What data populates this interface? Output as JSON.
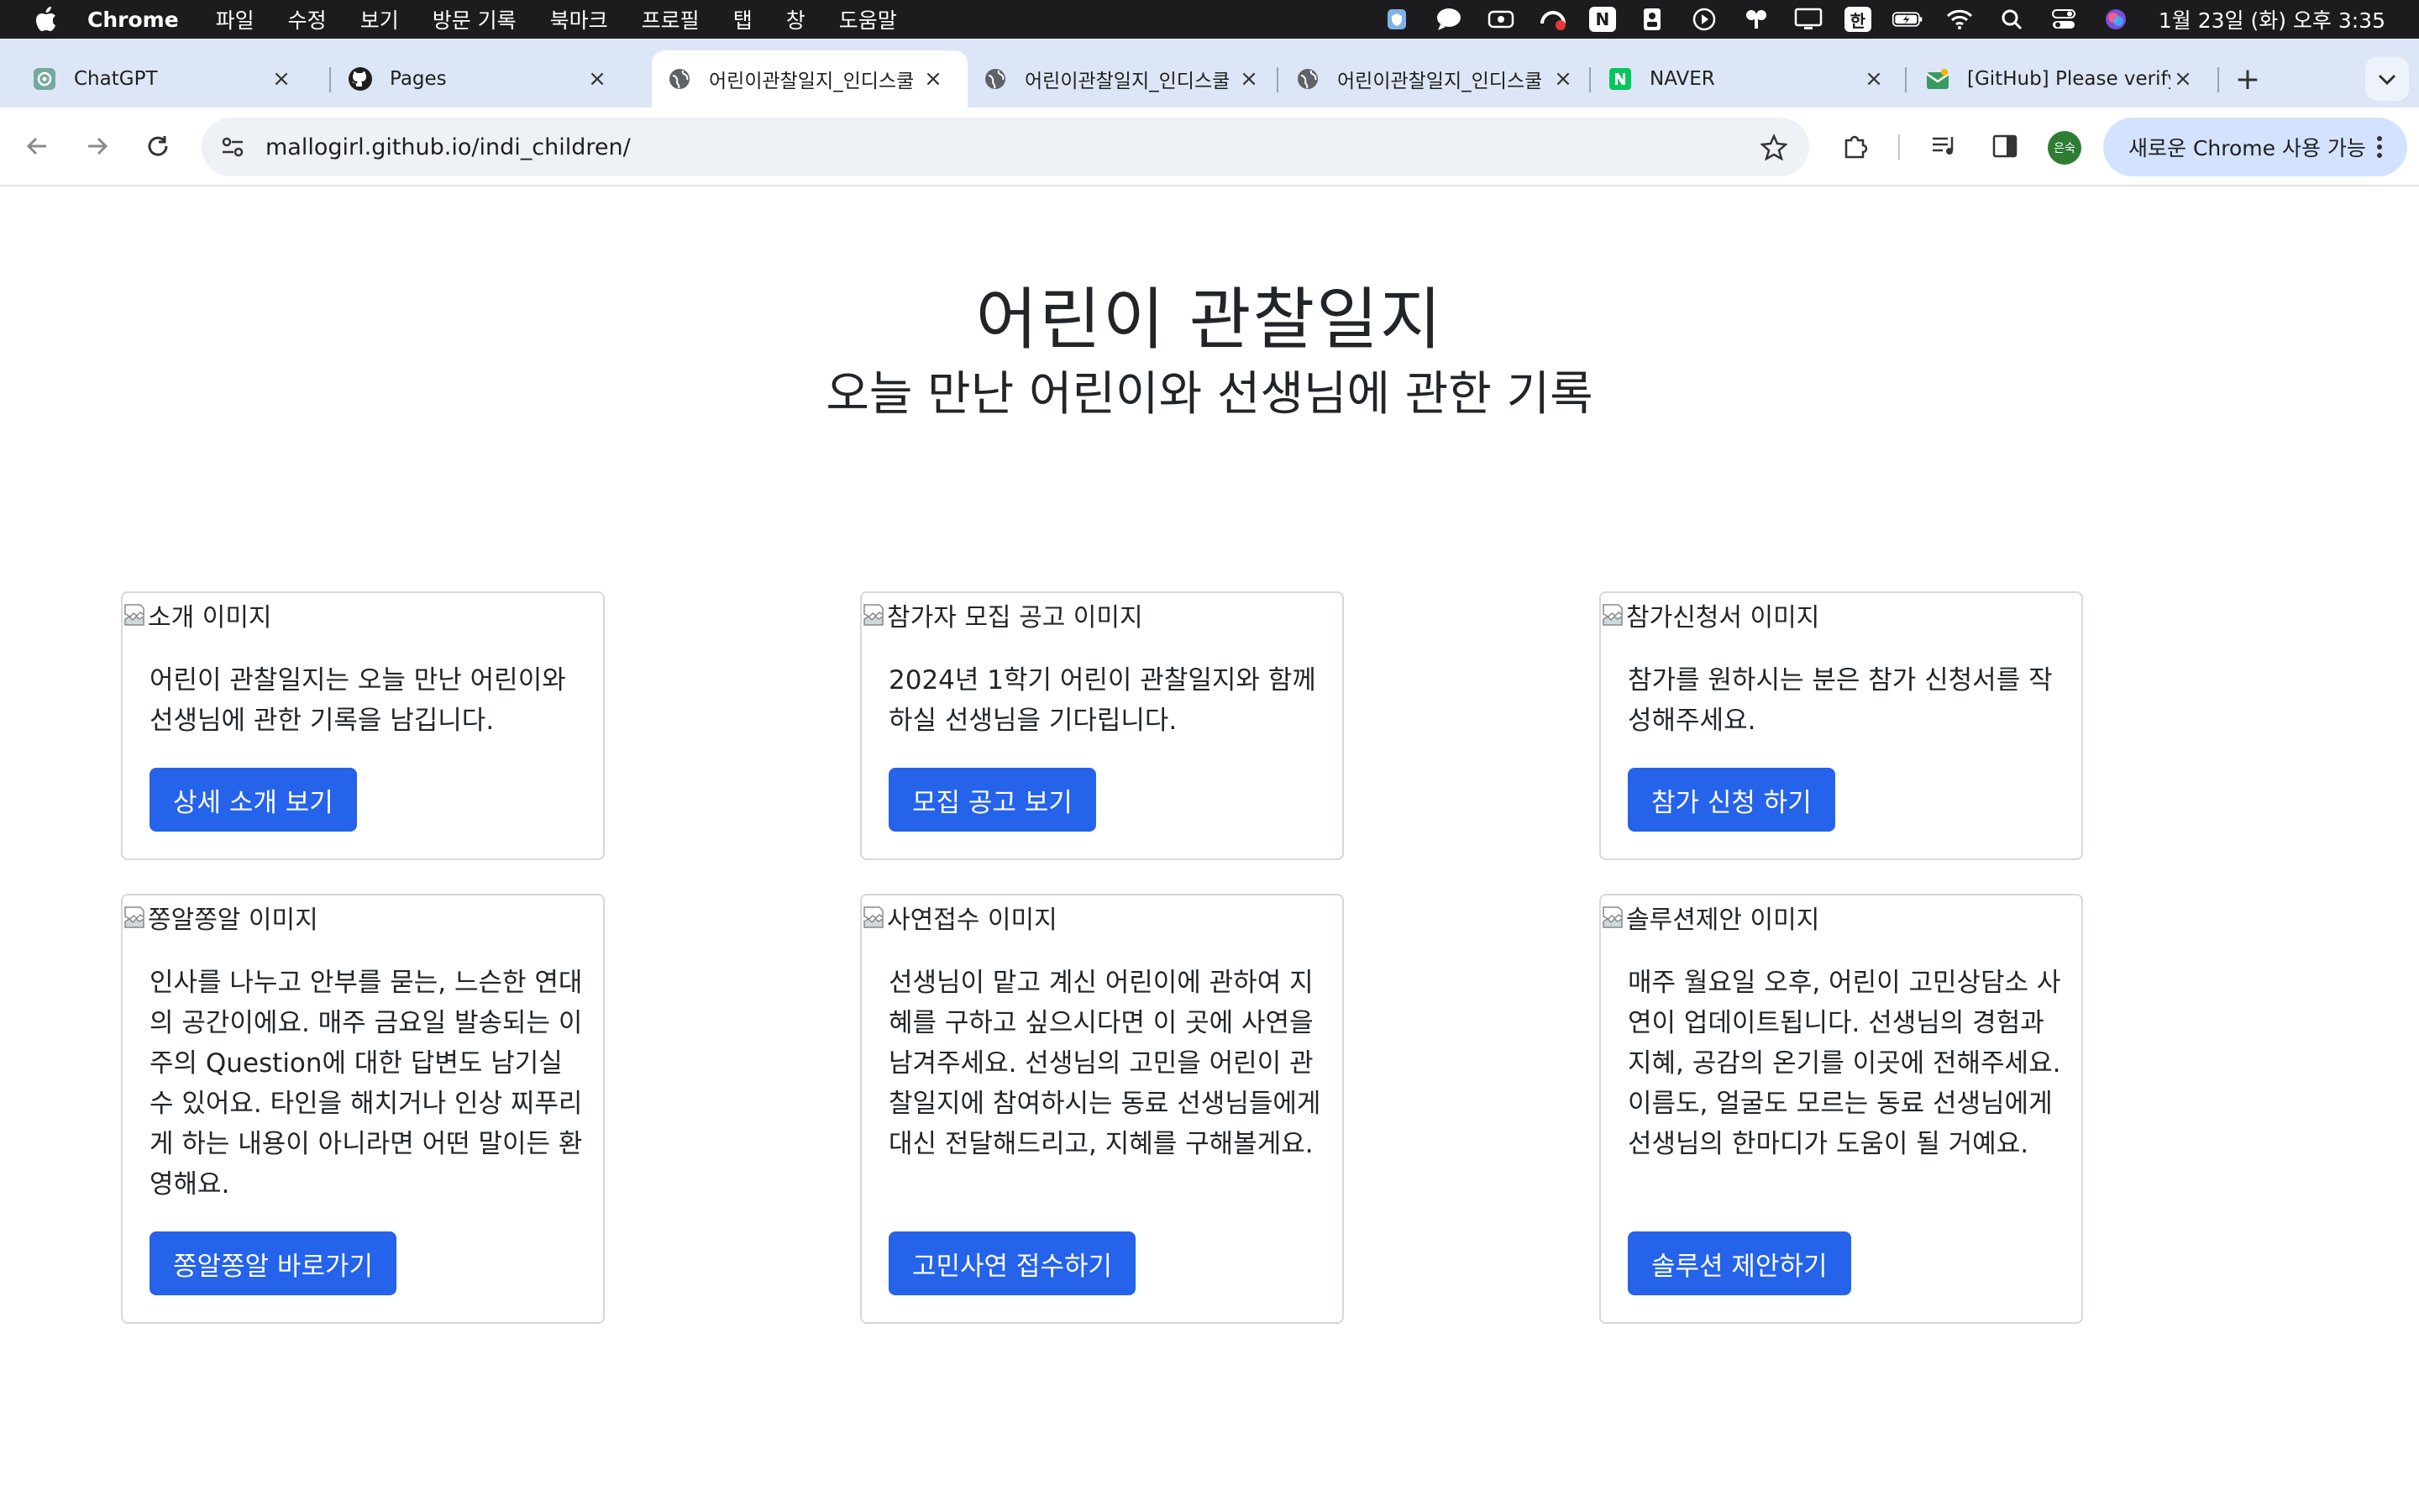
{
  "menubar": {
    "app_name": "Chrome",
    "items": [
      "파일",
      "수정",
      "보기",
      "방문 기록",
      "북마크",
      "프로필",
      "탭",
      "창",
      "도움말"
    ],
    "input_method": "한",
    "clock": "1월 23일 (화) 오후 3:35"
  },
  "tabs": [
    {
      "title": "ChatGPT",
      "icon": "chatgpt-icon"
    },
    {
      "title": "Pages",
      "icon": "github-icon"
    },
    {
      "title": "어린이관찰일지_인디스쿨",
      "icon": "globe-icon"
    },
    {
      "title": "어린이관찰일지_인디스쿨",
      "icon": "globe-icon"
    },
    {
      "title": "어린이관찰일지_인디스쿨",
      "icon": "globe-icon"
    },
    {
      "title": "NAVER",
      "icon": "naver-icon"
    },
    {
      "title": "[GitHub] Please verify",
      "icon": "gmail-icon"
    }
  ],
  "toolbar": {
    "url": "mallogirl.github.io/indi_children/",
    "profile_initials": "은숙",
    "update_label": "새로운 Chrome 사용 가능"
  },
  "page": {
    "title": "어린이 관찰일지",
    "subtitle": "오늘 만난 어린이와 선생님에 관한 기록"
  },
  "cards": [
    {
      "img_alt": "소개 이미지",
      "text": "어린이 관찰일지는 오늘 만난 어린이와 선생님에 관한 기록을 남깁니다.",
      "button": "상세 소개 보기"
    },
    {
      "img_alt": "참가자 모집 공고 이미지",
      "text": "2024년 1학기 어린이 관찰일지와 함께 하실 선생님을 기다립니다.",
      "button": "모집 공고 보기"
    },
    {
      "img_alt": "참가신청서 이미지",
      "text": "참가를 원하시는 분은 참가 신청서를 작성해주세요.",
      "button": "참가 신청 하기"
    },
    {
      "img_alt": "쫑알쫑알 이미지",
      "text": "인사를 나누고 안부를 묻는, 느슨한 연대의 공간이에요. 매주 금요일 발송되는 이주의 Question에 대한 답변도 남기실 수 있어요. 타인을 해치거나 인상 찌푸리게 하는 내용이 아니라면 어떤 말이든 환영해요.",
      "button": "쫑알쫑알 바로가기"
    },
    {
      "img_alt": "사연접수 이미지",
      "text": "선생님이 맡고 계신 어린이에 관하여 지혜를 구하고 싶으시다면 이 곳에 사연을 남겨주세요. 선생님의 고민을 어린이 관찰일지에 참여하시는 동료 선생님들에게 대신 전달해드리고, 지혜를 구해볼게요.",
      "button": "고민사연 접수하기"
    },
    {
      "img_alt": "솔루션제안 이미지",
      "text": "매주 월요일 오후, 어린이 고민상담소 사연이 업데이트됩니다. 선생님의 경험과 지혜, 공감의 온기를 이곳에 전해주세요. 이름도, 얼굴도 모르는 동료 선생님에게 선생님의 한마디가 도움이 될 거예요.",
      "button": "솔루션 제안하기"
    }
  ],
  "colors": {
    "primary_button": "#2563eb",
    "tab_strip": "#dde6f6",
    "menubar": "#1c1c1e"
  }
}
